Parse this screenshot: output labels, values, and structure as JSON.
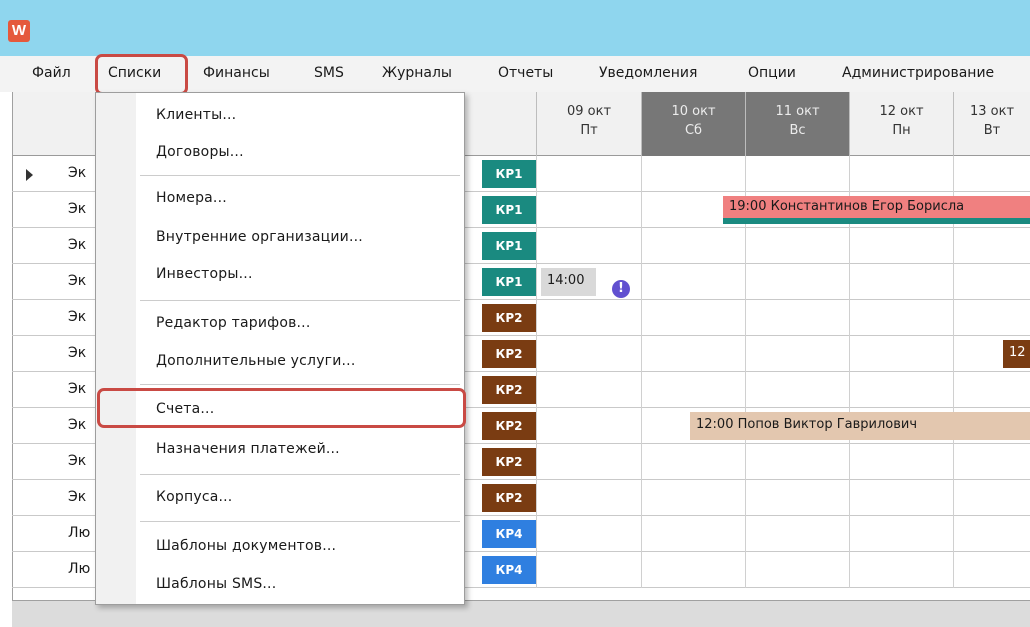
{
  "app": {
    "icon_letter": "W"
  },
  "menubar": {
    "items": [
      {
        "label": "Файл",
        "name": "menu-file"
      },
      {
        "label": "Списки",
        "name": "menu-lists"
      },
      {
        "label": "Финансы",
        "name": "menu-finance"
      },
      {
        "label": "SMS",
        "name": "menu-sms"
      },
      {
        "label": "Журналы",
        "name": "menu-journals"
      },
      {
        "label": "Отчеты",
        "name": "menu-reports"
      },
      {
        "label": "Уведомления",
        "name": "menu-notifications"
      },
      {
        "label": "Опции",
        "name": "menu-options"
      },
      {
        "label": "Администрирование",
        "name": "menu-admin"
      }
    ]
  },
  "dropdown": {
    "items": [
      "Клиенты...",
      "Договоры...",
      "Номера...",
      "Внутренние организации...",
      "Инвесторы...",
      "Редактор тарифов...",
      "Дополнительные услуги...",
      "Счета...",
      "Назначения платежей...",
      "Корпуса...",
      "Шаблоны документов...",
      "Шаблоны SMS..."
    ]
  },
  "calendar": {
    "days": [
      {
        "date": "09 окт",
        "weekday": "Пт",
        "weekend": false
      },
      {
        "date": "10 окт",
        "weekday": "Сб",
        "weekend": true
      },
      {
        "date": "11 окт",
        "weekday": "Вс",
        "weekend": true
      },
      {
        "date": "12 окт",
        "weekday": "Пн",
        "weekend": false
      },
      {
        "date": "13 окт",
        "weekday": "Вт",
        "weekend": false
      }
    ],
    "rows": [
      {
        "name": "Эк",
        "tag": "КР1",
        "tag_color": "#1a8a80"
      },
      {
        "name": "Эк",
        "tag": "КР1",
        "tag_color": "#1a8a80"
      },
      {
        "name": "Эк",
        "tag": "КР1",
        "tag_color": "#1a8a80"
      },
      {
        "name": "Эк",
        "tag": "КР1",
        "tag_color": "#1a8a80"
      },
      {
        "name": "Эк",
        "tag": "КР2",
        "tag_color": "#7a3c12"
      },
      {
        "name": "Эк",
        "tag": "КР2",
        "tag_color": "#7a3c12"
      },
      {
        "name": "Эк",
        "tag": "КР2",
        "tag_color": "#7a3c12"
      },
      {
        "name": "Эк",
        "tag": "КР2",
        "tag_color": "#7a3c12"
      },
      {
        "name": "Эк",
        "tag": "КР2",
        "tag_color": "#7a3c12"
      },
      {
        "name": "Эк",
        "tag": "КР2",
        "tag_color": "#7a3c12"
      },
      {
        "name": "Лю",
        "tag": "КР4",
        "tag_color": "#2f7fe0"
      },
      {
        "name": "Лю",
        "tag": "КР4",
        "tag_color": "#2f7fe0"
      }
    ],
    "bookings": [
      {
        "text": "19:00 Константинов Егор Борисла",
        "row": 1,
        "color": "#f08080",
        "underline": "#1a8a80"
      },
      {
        "text": "14:00",
        "row": 3,
        "color": "#d9d9d9"
      },
      {
        "text": "12",
        "row": 5,
        "color": "#7a3c12"
      },
      {
        "text": "12:00 Попов Виктор Гаврилович",
        "row": 7,
        "color": "#e3c7af"
      }
    ],
    "alert_symbol": "!"
  }
}
